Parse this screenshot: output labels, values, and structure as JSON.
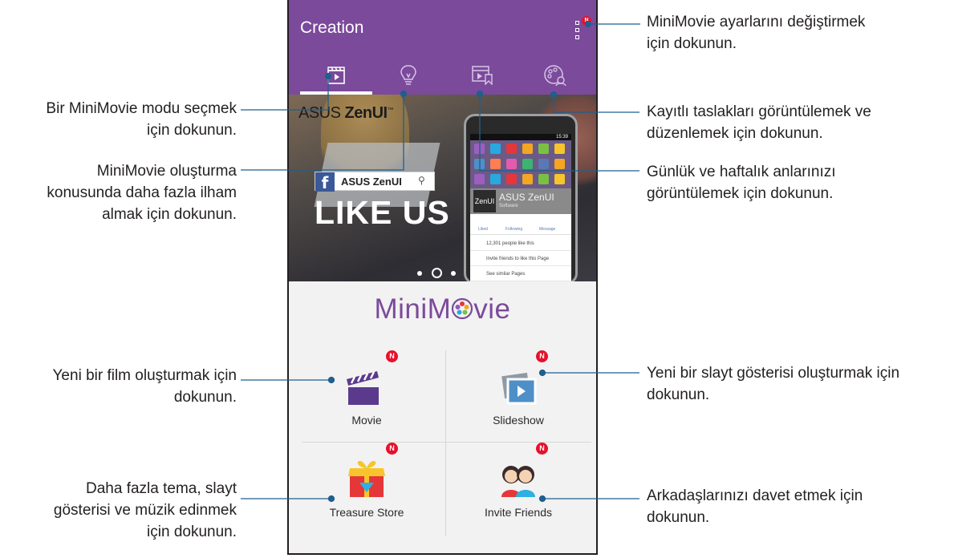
{
  "appbar": {
    "title": "Creation",
    "badge": "N",
    "color": "#7b4a9b",
    "tabs": [
      {
        "icon": "clapperboard-icon",
        "active": true
      },
      {
        "icon": "lightbulb-icon",
        "active": false
      },
      {
        "icon": "calendar-bookmark-icon",
        "active": false
      },
      {
        "icon": "palette-edit-icon",
        "active": false
      }
    ]
  },
  "banner": {
    "brand": "ASUS",
    "brand_zen": "ZenUI",
    "brand_tm": "™",
    "fb_letter": "f",
    "fb_page": "ASUS ZenUI",
    "headline": "LIKE US",
    "carousel_total": 3,
    "carousel_current": 2,
    "mini_phone": {
      "time": "15:39",
      "page_name": "ASUS ZenUI",
      "category": "Software",
      "logo": "ZenUI",
      "tabs": [
        "Liked",
        "Following",
        "Message"
      ],
      "likes_line": "12,301 people like this",
      "invite_line": "Invite friends to like this Page",
      "similar_line": "See similar Pages"
    }
  },
  "main": {
    "logo_text_a": "MiniM",
    "logo_text_b": "vie",
    "tiles": [
      {
        "label": "Movie",
        "badge": "N",
        "icon": "movie-clapper-icon"
      },
      {
        "label": "Slideshow",
        "badge": "N",
        "icon": "slideshow-icon"
      },
      {
        "label": "Treasure Store",
        "badge": "N",
        "icon": "treasure-store-icon"
      },
      {
        "label": "Invite Friends",
        "badge": "N",
        "icon": "invite-friends-icon"
      }
    ]
  },
  "callouts": {
    "settings": [
      "MiniMovie ayarlarını değiştirmek",
      "için dokunun."
    ],
    "mode": [
      "Bir MiniMovie modu seçmek",
      "için dokunun."
    ],
    "drafts": [
      "Kayıtlı taslakları görüntülemek ve",
      "düzenlemek için dokunun."
    ],
    "inspiration": [
      "MiniMovie oluşturma",
      "konusunda daha fazla ilham",
      "almak için dokunun."
    ],
    "moments": [
      "Günlük ve haftalık anlarınızı",
      "görüntülemek için dokunun."
    ],
    "movie": [
      "Yeni bir film oluşturmak için",
      "dokunun."
    ],
    "slideshow": [
      "Yeni bir slayt gösterisi oluşturmak için",
      "dokunun."
    ],
    "store": [
      "Daha fazla tema, slayt",
      "gösterisi ve müzik edinmek",
      "için dokunun."
    ],
    "invite": [
      "Arkadaşlarınızı davet etmek için",
      "dokunun."
    ]
  },
  "colors": {
    "leader": "#1f5f8e",
    "badge": "#e8102c",
    "purple": "#7b4a9b"
  }
}
